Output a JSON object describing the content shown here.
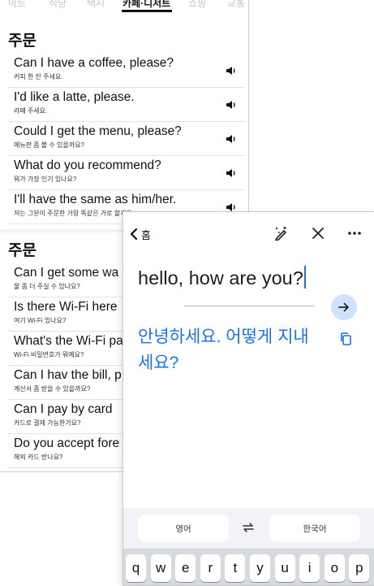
{
  "phrasebook": {
    "tabs": [
      {
        "label": "마트",
        "active": false
      },
      {
        "label": "식당",
        "active": false
      },
      {
        "label": "택시",
        "active": false
      },
      {
        "label": "카페·디저트",
        "active": true
      },
      {
        "label": "쇼핑",
        "active": false
      },
      {
        "label": "교통",
        "active": false
      }
    ],
    "sections": [
      {
        "title": "주문",
        "phrases": [
          {
            "en": "Can I have a coffee, please?",
            "ko": "커피 한 잔 주세요."
          },
          {
            "en": "I'd like a latte, please.",
            "ko": "라떼 주세요."
          },
          {
            "en": "Could I get the menu, please?",
            "ko": "메뉴판 좀 볼 수 있을까요?"
          },
          {
            "en": "What do you recommend?",
            "ko": "뭐가 가장 인기 있나요?"
          },
          {
            "en": "I'll have the same as him/her.",
            "ko": "저는 그분이 주문한 거랑 똑같은 거로 할게요."
          }
        ]
      },
      {
        "title": "주문",
        "phrases": [
          {
            "en": "Can I get some wa",
            "ko": "물 좀 더 주실 수 있나요?"
          },
          {
            "en": "Is there Wi-Fi here",
            "ko": "여기 Wi-Fi 있나요?"
          },
          {
            "en": "What's the Wi-Fi pa",
            "ko": "Wi-Fi 비밀번호가 뭐예요?"
          },
          {
            "en": "Can I hav the bill, p",
            "ko": "계산서 좀 받을 수 있을까요?"
          },
          {
            "en": "Can I pay by card",
            "ko": "카드로 결제 가능한가요?"
          },
          {
            "en": "Do you accept fore",
            "ko": "해외 카드 받나요?"
          }
        ]
      }
    ],
    "icons": {
      "speaker": "speaker-icon"
    }
  },
  "translator": {
    "header": {
      "back_label": "홈",
      "icons": [
        "chevron-left-icon",
        "pen-sparkle-icon",
        "close-icon",
        "more-icon"
      ]
    },
    "input_text": "hello, how are you?",
    "output_text": "안녕하세요. 어떻게 지내세요?",
    "source_language": "영어",
    "target_language": "한국어",
    "keyboard_keys": [
      "q",
      "w",
      "e",
      "r",
      "t",
      "y",
      "u",
      "i",
      "o",
      "p"
    ],
    "colors": {
      "accent": "#1a73e8",
      "go_button_bg": "#cfe3fb",
      "lang_bar_bg": "#f1f3f8",
      "keyboard_bg": "#d6d9de"
    }
  }
}
